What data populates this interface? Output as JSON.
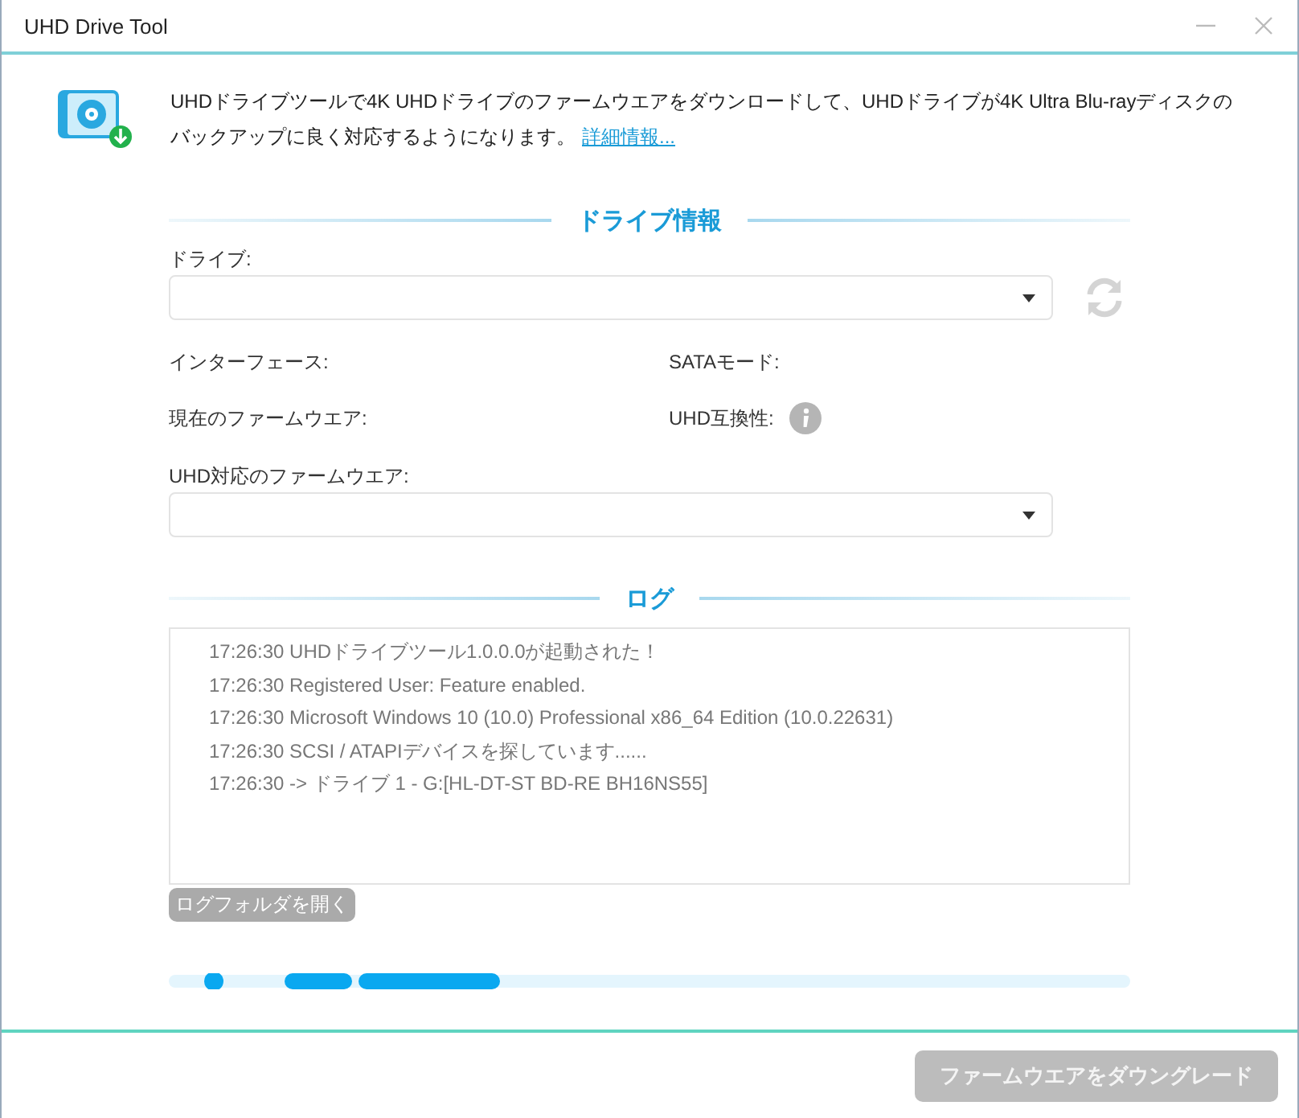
{
  "window": {
    "title": "UHD Drive Tool"
  },
  "intro": {
    "text": "UHDドライブツールで4K UHDドライブのファームウエアをダウンロードして、UHDドライブが4K Ultra Blu-rayディスクのバックアップに良く対応するようになります。",
    "link": "詳細情報..."
  },
  "drive_section": {
    "heading": "ドライブ情報",
    "drive_label": "ドライブ:",
    "interface_label": "インターフェース:",
    "sata_label": "SATAモード:",
    "firmware_label": "現在のファームウエア:",
    "compat_label": "UHD互換性:",
    "uhd_firmware_label": "UHD対応のファームウエア:"
  },
  "log_section": {
    "heading": "ログ",
    "lines": [
      "17:26:30 UHDドライブツール1.0.0.0が起動された！",
      "17:26:30 Registered User: Feature enabled.",
      "17:26:30 Microsoft Windows 10 (10.0) Professional x86_64 Edition (10.0.22631)",
      "17:26:30 SCSI / ATAPIデバイスを探しています......",
      "17:26:30 -> ドライブ 1 - G:[HL-DT-ST BD-RE BH16NS55]"
    ],
    "open_folder_button": "ログフォルダを開く"
  },
  "progress": {
    "kind": "indeterminate"
  },
  "downgrade_button": {
    "label": "ファームウエアをダウングレード",
    "disabled": true
  }
}
